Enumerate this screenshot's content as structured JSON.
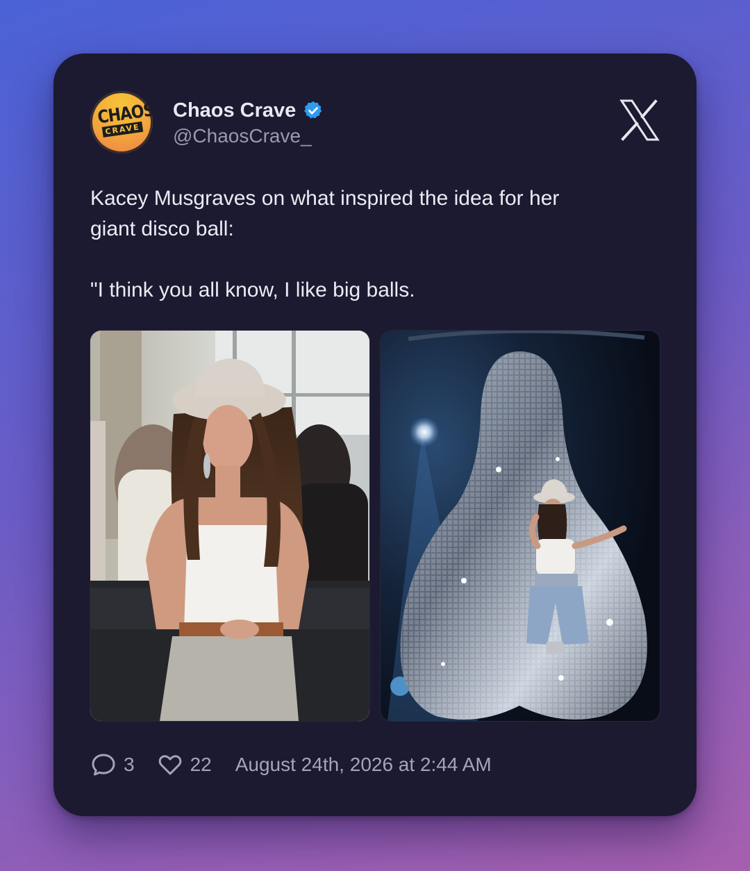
{
  "post": {
    "display_name": "Chaos Crave",
    "handle": "@ChaosCrave_",
    "verified": true,
    "avatar": {
      "logo_line1": "CHAOS",
      "logo_line2": "CRAVE"
    },
    "text": "Kacey Musgraves on what inspired the idea for her\ngiant disco ball:\n\n\"I think you all know, I like big balls.",
    "images": [
      {
        "name": "woman-in-cowboy-hat-photo"
      },
      {
        "name": "disco-ball-stage-photo"
      }
    ],
    "replies_count": "3",
    "likes_count": "22",
    "timestamp": "August 24th, 2026 at 2:44 AM"
  },
  "icons": {
    "verified": "verified-badge-icon",
    "platform": "x-logo-icon",
    "reply": "reply-bubble-icon",
    "like": "heart-icon"
  },
  "colors": {
    "card_bg": "#1b1a31",
    "verified_blue": "#2f9bef",
    "text_primary": "#ecebf3",
    "text_secondary": "#9a99ad"
  }
}
